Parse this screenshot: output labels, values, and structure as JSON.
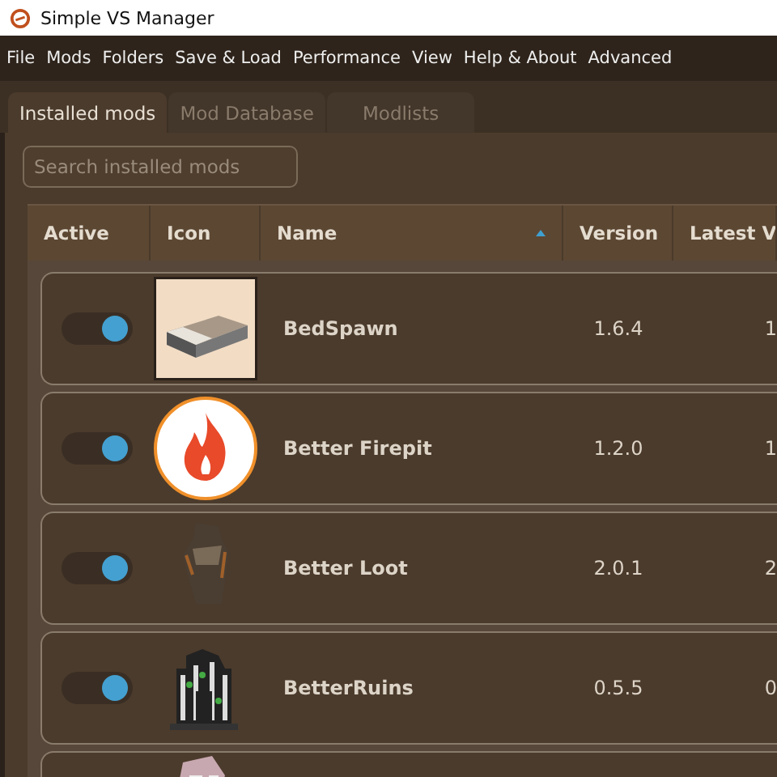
{
  "window": {
    "title": "Simple VS Manager"
  },
  "menu": [
    "File",
    "Mods",
    "Folders",
    "Save & Load",
    "Performance",
    "View",
    "Help & About",
    "Advanced"
  ],
  "tabs": [
    {
      "label": "Installed mods",
      "selected": true
    },
    {
      "label": "Mod Database",
      "selected": false
    },
    {
      "label": "Modlists",
      "selected": false
    }
  ],
  "search": {
    "placeholder": "Search installed mods"
  },
  "table": {
    "columns": [
      {
        "label": "Active",
        "sorted": false
      },
      {
        "label": "Icon",
        "sorted": false
      },
      {
        "label": "Name",
        "sorted": true
      },
      {
        "label": "Version",
        "sorted": false
      },
      {
        "label": "Latest V",
        "sorted": false
      }
    ],
    "rows": [
      {
        "on": true,
        "kind": "bed",
        "name": "BedSpawn",
        "version": "1.6.4",
        "latest": "1"
      },
      {
        "on": true,
        "kind": "flame",
        "name": "Better Firepit",
        "version": "1.2.0",
        "latest": "1"
      },
      {
        "on": true,
        "kind": "figure",
        "name": "Better Loot",
        "version": "2.0.1",
        "latest": "2"
      },
      {
        "on": true,
        "kind": "ruin",
        "name": "BetterRuins",
        "version": "0.5.5",
        "latest": "0"
      },
      {
        "kind": "creature"
      }
    ]
  }
}
